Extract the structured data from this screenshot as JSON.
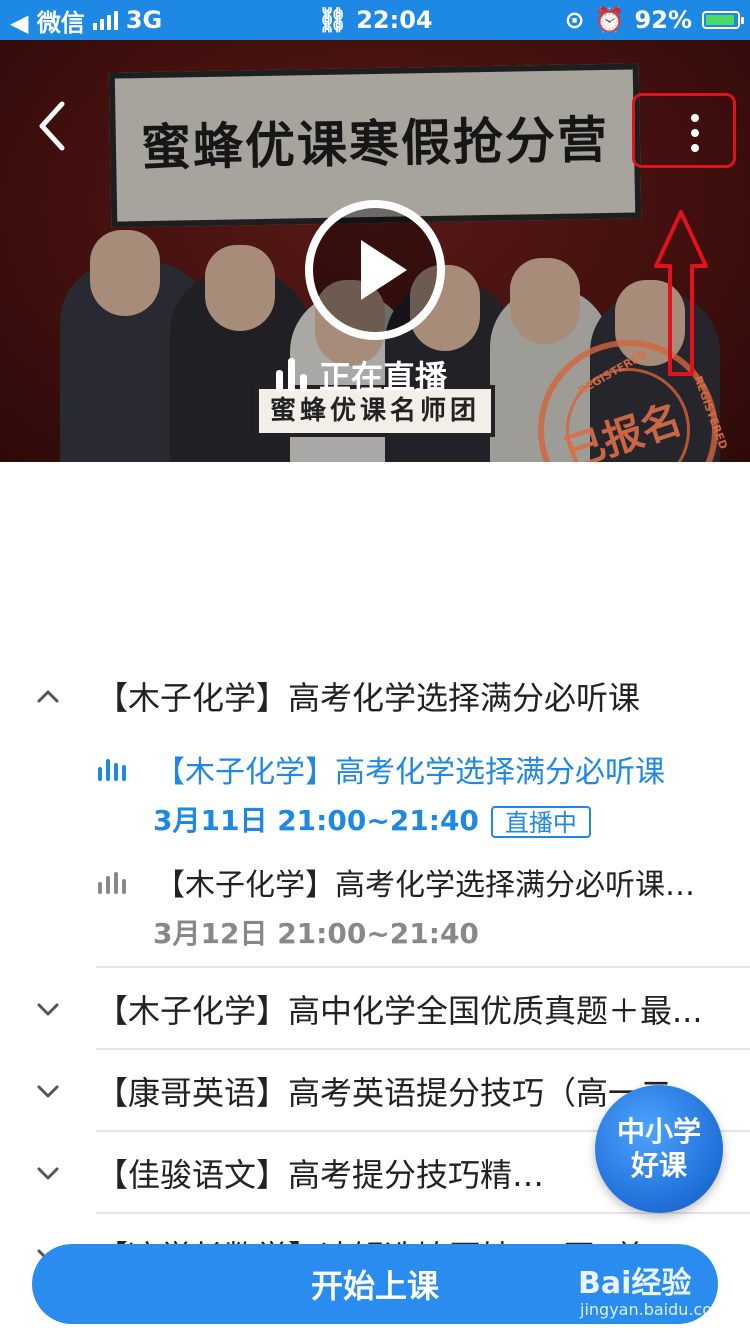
{
  "status_bar": {
    "back_app": "◀ 微信",
    "network": "3G",
    "time": "22:04",
    "battery": "92%"
  },
  "banner": {
    "board_title": "蜜蜂优课寒假抢分营",
    "tag": "蜜蜂优课名师团",
    "live_text": "正在直播",
    "stamp_text": "已报名",
    "stamp_small_1": "REGISTERED",
    "stamp_small_2": "REGISTERED"
  },
  "sections": [
    {
      "title": "【木子化学】高考化学选择满分必听课",
      "expanded": true,
      "lessons": [
        {
          "title": "【木子化学】高考化学选择满分必听课",
          "time": "3月11日 21:00~21:40",
          "badge": "直播中",
          "active": true
        },
        {
          "title": "【木子化学】高考化学选择满分必听课（...",
          "time": "3月12日 21:00~21:40",
          "active": false
        }
      ]
    },
    {
      "title": "【木子化学】高中化学全国优质真题＋最...",
      "expanded": false
    },
    {
      "title": "【康哥英语】高考英语提分技巧（高一二...",
      "expanded": false
    },
    {
      "title": "【佳骏语文】高考提分技巧精品课",
      "expanded": false
    },
    {
      "title": "【凉学长数学】速解选填压轴，x同x着",
      "expanded": false
    }
  ],
  "float_badge": {
    "line1": "中小学",
    "line2": "好课"
  },
  "start_button": "开始上课",
  "watermark": {
    "brand": "Bai经验",
    "url": "jingyan.baidu.com"
  },
  "colors": {
    "accent": "#1e88e5",
    "annotation_red": "#e0121d"
  }
}
